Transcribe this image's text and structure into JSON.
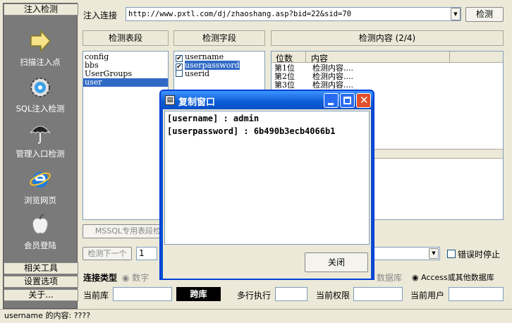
{
  "sidebar": {
    "top_button": "注入检测",
    "items": [
      {
        "label": "扫描注入点",
        "icon": "arrow-right-icon"
      },
      {
        "label": "SQL注入检测",
        "icon": "gear-globe-icon"
      },
      {
        "label": "管理入口检测",
        "icon": "umbrella-icon"
      },
      {
        "label": "浏览网页",
        "icon": "internet-explorer-icon"
      },
      {
        "label": "会员登陆",
        "icon": "apple-icon"
      }
    ],
    "bottom_buttons": [
      "相关工具",
      "设置选项",
      "关于..."
    ]
  },
  "toolbar": {
    "url_label": "注入连接",
    "url_value": "http://www.pxtl.com/dj/zhaoshang.asp?bid=22&sid=70",
    "detect_button": "检测"
  },
  "panels": {
    "tables_header": "检测表段",
    "fields_header": "检测字段",
    "content_header": "检测内容 (2/4)",
    "tables": [
      "config",
      "bbs",
      "UserGroups",
      "user"
    ],
    "fields": [
      {
        "name": "username",
        "checked": true
      },
      {
        "name": "userpassword",
        "checked": true
      },
      {
        "name": "userid",
        "checked": false
      }
    ],
    "content_columns": [
      "位数",
      "内容"
    ],
    "content_rows": [
      {
        "pos": "第1位",
        "val": "检测内容...."
      },
      {
        "pos": "第2位",
        "val": "检测内容...."
      },
      {
        "pos": "第3位",
        "val": "检测内容...."
      }
    ]
  },
  "controls": {
    "mssql_button": "MSSQL专用表段检测",
    "next_button": "检测下一个",
    "next_value": "1",
    "stop_on_error": "错误时停止",
    "connection_type_label": "连接类型",
    "option_digit": "数字",
    "option_db": "数据库",
    "option_access": "Access或其他数据库",
    "current_db_label": "当前库",
    "cross_db_button": "跨库",
    "multi_exec_label": "多行执行",
    "current_perm_label": "当前权限",
    "current_user_label": "当前用户"
  },
  "dialog": {
    "title": "复制窗口",
    "line1": "[username] : admin",
    "line2": "[userpassword] : 6b490b3ecb4066b1",
    "close_button": "关闭"
  },
  "status": {
    "text": "username 的内容: ????"
  }
}
